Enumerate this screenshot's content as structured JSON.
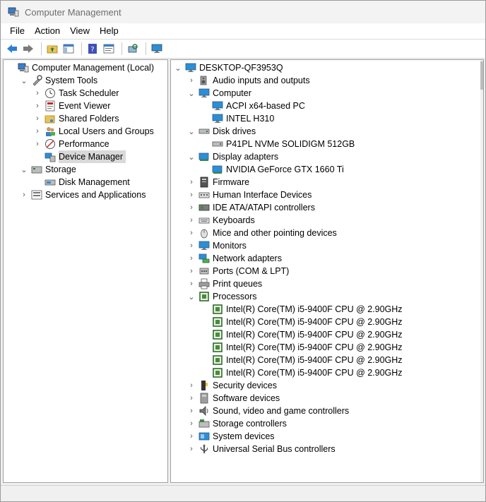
{
  "window": {
    "title": "Computer Management"
  },
  "menu": [
    "File",
    "Action",
    "View",
    "Help"
  ],
  "left_tree": [
    {
      "label": "Computer Management (Local)",
      "indent": 0,
      "chev": "",
      "icon": "computer-management-icon"
    },
    {
      "label": "System Tools",
      "indent": 1,
      "chev": "⌄",
      "icon": "system-tools-icon"
    },
    {
      "label": "Task Scheduler",
      "indent": 2,
      "chev": "›",
      "icon": "clock-icon"
    },
    {
      "label": "Event Viewer",
      "indent": 2,
      "chev": "›",
      "icon": "event-viewer-icon"
    },
    {
      "label": "Shared Folders",
      "indent": 2,
      "chev": "›",
      "icon": "shared-folder-icon"
    },
    {
      "label": "Local Users and Groups",
      "indent": 2,
      "chev": "›",
      "icon": "users-icon"
    },
    {
      "label": "Performance",
      "indent": 2,
      "chev": "›",
      "icon": "performance-icon"
    },
    {
      "label": "Device Manager",
      "indent": 2,
      "chev": "",
      "icon": "device-manager-icon",
      "selected": true
    },
    {
      "label": "Storage",
      "indent": 1,
      "chev": "⌄",
      "icon": "storage-icon"
    },
    {
      "label": "Disk Management",
      "indent": 2,
      "chev": "",
      "icon": "disk-management-icon"
    },
    {
      "label": "Services and Applications",
      "indent": 1,
      "chev": "›",
      "icon": "services-icon"
    }
  ],
  "right_tree": [
    {
      "label": "DESKTOP-QF3953Q",
      "indent": 0,
      "chev": "⌄",
      "icon": "computer-icon"
    },
    {
      "label": "Audio inputs and outputs",
      "indent": 1,
      "chev": "›",
      "icon": "speaker-icon"
    },
    {
      "label": "Computer",
      "indent": 1,
      "chev": "⌄",
      "icon": "monitor-icon"
    },
    {
      "label": "ACPI x64-based PC",
      "indent": 2,
      "chev": "",
      "icon": "monitor-icon"
    },
    {
      "label": "INTEL H310",
      "indent": 2,
      "chev": "",
      "icon": "monitor-icon"
    },
    {
      "label": "Disk drives",
      "indent": 1,
      "chev": "⌄",
      "icon": "disk-drive-icon"
    },
    {
      "label": "P41PL NVMe SOLIDIGM 512GB",
      "indent": 2,
      "chev": "",
      "icon": "disk-drive-icon"
    },
    {
      "label": "Display adapters",
      "indent": 1,
      "chev": "⌄",
      "icon": "display-adapter-icon"
    },
    {
      "label": "NVIDIA GeForce GTX 1660 Ti",
      "indent": 2,
      "chev": "",
      "icon": "display-adapter-icon"
    },
    {
      "label": "Firmware",
      "indent": 1,
      "chev": "›",
      "icon": "firmware-icon"
    },
    {
      "label": "Human Interface Devices",
      "indent": 1,
      "chev": "›",
      "icon": "hid-icon"
    },
    {
      "label": "IDE ATA/ATAPI controllers",
      "indent": 1,
      "chev": "›",
      "icon": "ide-controller-icon"
    },
    {
      "label": "Keyboards",
      "indent": 1,
      "chev": "›",
      "icon": "keyboard-icon"
    },
    {
      "label": "Mice and other pointing devices",
      "indent": 1,
      "chev": "›",
      "icon": "mouse-icon"
    },
    {
      "label": "Monitors",
      "indent": 1,
      "chev": "›",
      "icon": "monitor-icon"
    },
    {
      "label": "Network adapters",
      "indent": 1,
      "chev": "›",
      "icon": "network-adapter-icon"
    },
    {
      "label": "Ports (COM & LPT)",
      "indent": 1,
      "chev": "›",
      "icon": "port-icon"
    },
    {
      "label": "Print queues",
      "indent": 1,
      "chev": "›",
      "icon": "printer-icon"
    },
    {
      "label": "Processors",
      "indent": 1,
      "chev": "⌄",
      "icon": "processor-icon"
    },
    {
      "label": "Intel(R) Core(TM) i5-9400F CPU @ 2.90GHz",
      "indent": 2,
      "chev": "",
      "icon": "processor-icon"
    },
    {
      "label": "Intel(R) Core(TM) i5-9400F CPU @ 2.90GHz",
      "indent": 2,
      "chev": "",
      "icon": "processor-icon"
    },
    {
      "label": "Intel(R) Core(TM) i5-9400F CPU @ 2.90GHz",
      "indent": 2,
      "chev": "",
      "icon": "processor-icon"
    },
    {
      "label": "Intel(R) Core(TM) i5-9400F CPU @ 2.90GHz",
      "indent": 2,
      "chev": "",
      "icon": "processor-icon"
    },
    {
      "label": "Intel(R) Core(TM) i5-9400F CPU @ 2.90GHz",
      "indent": 2,
      "chev": "",
      "icon": "processor-icon"
    },
    {
      "label": "Intel(R) Core(TM) i5-9400F CPU @ 2.90GHz",
      "indent": 2,
      "chev": "",
      "icon": "processor-icon"
    },
    {
      "label": "Security devices",
      "indent": 1,
      "chev": "›",
      "icon": "security-device-icon"
    },
    {
      "label": "Software devices",
      "indent": 1,
      "chev": "›",
      "icon": "software-device-icon"
    },
    {
      "label": "Sound, video and game controllers",
      "indent": 1,
      "chev": "›",
      "icon": "sound-controller-icon"
    },
    {
      "label": "Storage controllers",
      "indent": 1,
      "chev": "›",
      "icon": "storage-controller-icon"
    },
    {
      "label": "System devices",
      "indent": 1,
      "chev": "›",
      "icon": "system-device-icon"
    },
    {
      "label": "Universal Serial Bus controllers",
      "indent": 1,
      "chev": "›",
      "icon": "usb-icon"
    }
  ],
  "toolbar": [
    "back-arrow-icon",
    "forward-arrow-icon",
    "up-folder-icon",
    "show-hide-tree-icon",
    "help-icon",
    "properties-icon",
    "scan-hardware-icon",
    "display-icon"
  ]
}
